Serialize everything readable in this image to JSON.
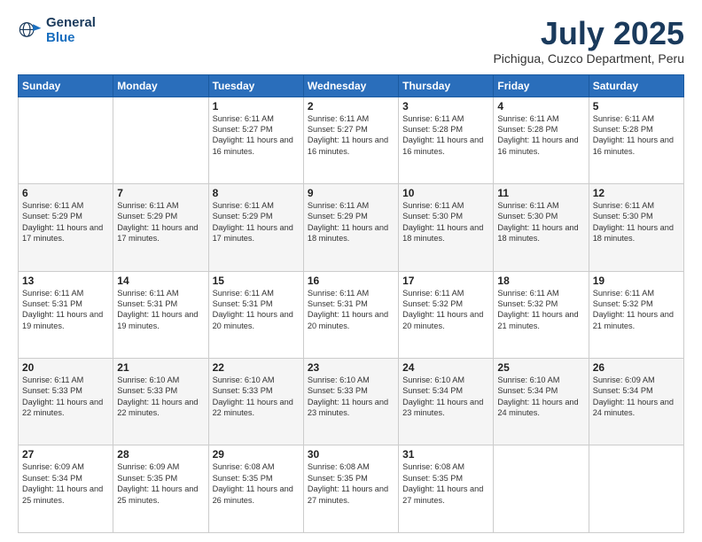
{
  "header": {
    "logo_line1": "General",
    "logo_line2": "Blue",
    "main_title": "July 2025",
    "subtitle": "Pichigua, Cuzco Department, Peru"
  },
  "calendar": {
    "days_of_week": [
      "Sunday",
      "Monday",
      "Tuesday",
      "Wednesday",
      "Thursday",
      "Friday",
      "Saturday"
    ],
    "weeks": [
      [
        {
          "day": "",
          "info": ""
        },
        {
          "day": "",
          "info": ""
        },
        {
          "day": "1",
          "info": "Sunrise: 6:11 AM\nSunset: 5:27 PM\nDaylight: 11 hours and 16 minutes."
        },
        {
          "day": "2",
          "info": "Sunrise: 6:11 AM\nSunset: 5:27 PM\nDaylight: 11 hours and 16 minutes."
        },
        {
          "day": "3",
          "info": "Sunrise: 6:11 AM\nSunset: 5:28 PM\nDaylight: 11 hours and 16 minutes."
        },
        {
          "day": "4",
          "info": "Sunrise: 6:11 AM\nSunset: 5:28 PM\nDaylight: 11 hours and 16 minutes."
        },
        {
          "day": "5",
          "info": "Sunrise: 6:11 AM\nSunset: 5:28 PM\nDaylight: 11 hours and 16 minutes."
        }
      ],
      [
        {
          "day": "6",
          "info": "Sunrise: 6:11 AM\nSunset: 5:29 PM\nDaylight: 11 hours and 17 minutes."
        },
        {
          "day": "7",
          "info": "Sunrise: 6:11 AM\nSunset: 5:29 PM\nDaylight: 11 hours and 17 minutes."
        },
        {
          "day": "8",
          "info": "Sunrise: 6:11 AM\nSunset: 5:29 PM\nDaylight: 11 hours and 17 minutes."
        },
        {
          "day": "9",
          "info": "Sunrise: 6:11 AM\nSunset: 5:29 PM\nDaylight: 11 hours and 18 minutes."
        },
        {
          "day": "10",
          "info": "Sunrise: 6:11 AM\nSunset: 5:30 PM\nDaylight: 11 hours and 18 minutes."
        },
        {
          "day": "11",
          "info": "Sunrise: 6:11 AM\nSunset: 5:30 PM\nDaylight: 11 hours and 18 minutes."
        },
        {
          "day": "12",
          "info": "Sunrise: 6:11 AM\nSunset: 5:30 PM\nDaylight: 11 hours and 18 minutes."
        }
      ],
      [
        {
          "day": "13",
          "info": "Sunrise: 6:11 AM\nSunset: 5:31 PM\nDaylight: 11 hours and 19 minutes."
        },
        {
          "day": "14",
          "info": "Sunrise: 6:11 AM\nSunset: 5:31 PM\nDaylight: 11 hours and 19 minutes."
        },
        {
          "day": "15",
          "info": "Sunrise: 6:11 AM\nSunset: 5:31 PM\nDaylight: 11 hours and 20 minutes."
        },
        {
          "day": "16",
          "info": "Sunrise: 6:11 AM\nSunset: 5:31 PM\nDaylight: 11 hours and 20 minutes."
        },
        {
          "day": "17",
          "info": "Sunrise: 6:11 AM\nSunset: 5:32 PM\nDaylight: 11 hours and 20 minutes."
        },
        {
          "day": "18",
          "info": "Sunrise: 6:11 AM\nSunset: 5:32 PM\nDaylight: 11 hours and 21 minutes."
        },
        {
          "day": "19",
          "info": "Sunrise: 6:11 AM\nSunset: 5:32 PM\nDaylight: 11 hours and 21 minutes."
        }
      ],
      [
        {
          "day": "20",
          "info": "Sunrise: 6:11 AM\nSunset: 5:33 PM\nDaylight: 11 hours and 22 minutes."
        },
        {
          "day": "21",
          "info": "Sunrise: 6:10 AM\nSunset: 5:33 PM\nDaylight: 11 hours and 22 minutes."
        },
        {
          "day": "22",
          "info": "Sunrise: 6:10 AM\nSunset: 5:33 PM\nDaylight: 11 hours and 22 minutes."
        },
        {
          "day": "23",
          "info": "Sunrise: 6:10 AM\nSunset: 5:33 PM\nDaylight: 11 hours and 23 minutes."
        },
        {
          "day": "24",
          "info": "Sunrise: 6:10 AM\nSunset: 5:34 PM\nDaylight: 11 hours and 23 minutes."
        },
        {
          "day": "25",
          "info": "Sunrise: 6:10 AM\nSunset: 5:34 PM\nDaylight: 11 hours and 24 minutes."
        },
        {
          "day": "26",
          "info": "Sunrise: 6:09 AM\nSunset: 5:34 PM\nDaylight: 11 hours and 24 minutes."
        }
      ],
      [
        {
          "day": "27",
          "info": "Sunrise: 6:09 AM\nSunset: 5:34 PM\nDaylight: 11 hours and 25 minutes."
        },
        {
          "day": "28",
          "info": "Sunrise: 6:09 AM\nSunset: 5:35 PM\nDaylight: 11 hours and 25 minutes."
        },
        {
          "day": "29",
          "info": "Sunrise: 6:08 AM\nSunset: 5:35 PM\nDaylight: 11 hours and 26 minutes."
        },
        {
          "day": "30",
          "info": "Sunrise: 6:08 AM\nSunset: 5:35 PM\nDaylight: 11 hours and 27 minutes."
        },
        {
          "day": "31",
          "info": "Sunrise: 6:08 AM\nSunset: 5:35 PM\nDaylight: 11 hours and 27 minutes."
        },
        {
          "day": "",
          "info": ""
        },
        {
          "day": "",
          "info": ""
        }
      ]
    ]
  }
}
